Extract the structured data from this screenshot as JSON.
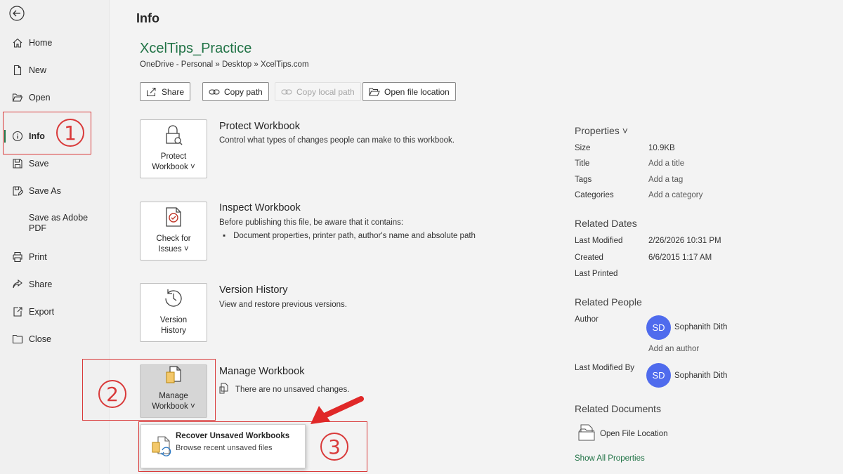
{
  "sidebar": {
    "items": [
      {
        "label": "Home",
        "icon": "home-icon"
      },
      {
        "label": "New",
        "icon": "new-file-icon"
      },
      {
        "label": "Open",
        "icon": "folder-open-icon"
      },
      {
        "label": "Info",
        "icon": "info-icon"
      },
      {
        "label": "Save",
        "icon": "save-icon"
      },
      {
        "label": "Save As",
        "icon": "save-as-icon"
      },
      {
        "label": "Save as Adobe PDF",
        "label_lines": [
          "Save as Adobe",
          "PDF"
        ],
        "icon": ""
      },
      {
        "label": "Print",
        "icon": "printer-icon"
      },
      {
        "label": "Share",
        "icon": "share-icon"
      },
      {
        "label": "Export",
        "icon": "export-icon"
      },
      {
        "label": "Close",
        "icon": "close-folder-icon"
      }
    ]
  },
  "header": {
    "title": "Info",
    "doc_name": "XcelTips_Practice",
    "doc_path": "OneDrive - Personal » Desktop » XcelTips.com"
  },
  "actions": {
    "share": "Share",
    "copy_path": "Copy path",
    "copy_local_path": "Copy local path",
    "open_file_location": "Open file location"
  },
  "sections": {
    "protect": {
      "tile_line1": "Protect",
      "tile_line2": "Workbook ˅",
      "title": "Protect Workbook",
      "desc": "Control what types of changes people can make to this workbook."
    },
    "inspect": {
      "tile_line1": "Check for",
      "tile_line2": "Issues ˅",
      "title": "Inspect Workbook",
      "desc": "Before publishing this file, be aware that it contains:",
      "bullet": "Document properties, printer path, author's name and absolute path"
    },
    "version": {
      "tile_line1": "Version",
      "tile_line2": "History",
      "title": "Version History",
      "desc": "View and restore previous versions."
    },
    "manage": {
      "tile_line1": "Manage",
      "tile_line2": "Workbook ˅",
      "title": "Manage Workbook",
      "desc": "There are no unsaved changes."
    }
  },
  "dropdown": {
    "title": "Recover Unsaved Workbooks",
    "desc": "Browse recent unsaved files"
  },
  "properties": {
    "heading": "Properties ˅",
    "size_label": "Size",
    "size_value": "10.9KB",
    "title_label": "Title",
    "title_value": "Add a title",
    "tags_label": "Tags",
    "tags_value": "Add a tag",
    "categories_label": "Categories",
    "categories_value": "Add a category",
    "dates_heading": "Related Dates",
    "modified_label": "Last Modified",
    "modified_value": "2/26/2026 10:31 PM",
    "created_label": "Created",
    "created_value": "6/6/2015 1:17 AM",
    "printed_label": "Last Printed",
    "people_heading": "Related People",
    "author_label": "Author",
    "author_initials": "SD",
    "author_name": "Sophanith Dith",
    "add_author": "Add an author",
    "modified_by_label": "Last Modified By",
    "modified_by_initials": "SD",
    "modified_by_name": "Sophanith Dith",
    "docs_heading": "Related Documents",
    "open_file_location": "Open File Location",
    "show_all": "Show All Properties"
  },
  "annotations": {
    "step1": "1",
    "step2": "2",
    "step3": "3"
  },
  "colors": {
    "accent": "#217346",
    "annotation": "#d93a3a",
    "avatar": "#4f6bed"
  }
}
